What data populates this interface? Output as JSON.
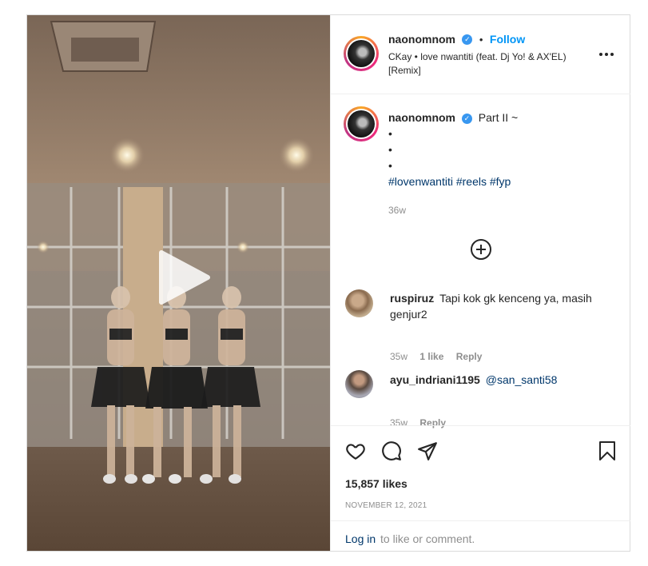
{
  "header": {
    "username": "naonomnom",
    "separator": "•",
    "follow_label": "Follow",
    "audio": "CKay • love nwantiti (feat. Dj Yo! & AX'EL) [Remix]",
    "more_icon": "more-horizontal-icon"
  },
  "caption": {
    "username": "naonomnom",
    "text": "Part II ~",
    "bullets": [
      "•",
      "•",
      "•"
    ],
    "hashtags": [
      "#lovenwantiti",
      "#reels",
      "#fyp"
    ],
    "time": "36w"
  },
  "load_more_icon": "plus-circle-icon",
  "comments": [
    {
      "username": "ruspiruz",
      "text": "Tapi kok gk kenceng ya, masih genjur2",
      "time": "35w",
      "likes": "1 like",
      "reply_label": "Reply"
    },
    {
      "username": "ayu_indriani1195",
      "text": "@san_santi58",
      "time": "35w",
      "reply_label": "Reply"
    }
  ],
  "actions": {
    "like_icon": "heart-icon",
    "comment_icon": "comment-icon",
    "share_icon": "send-icon",
    "save_icon": "bookmark-icon"
  },
  "likes": "15,857 likes",
  "date": "NOVEMBER 12, 2021",
  "footer": {
    "login_label": "Log in",
    "rest": "to like or comment."
  },
  "media": {
    "play_icon": "play-icon"
  },
  "colors": {
    "link_blue": "#0095f6",
    "hashtag": "#00376b",
    "verified": "#3897f0",
    "muted": "#8e8e8e",
    "border": "#dbdbdb"
  }
}
